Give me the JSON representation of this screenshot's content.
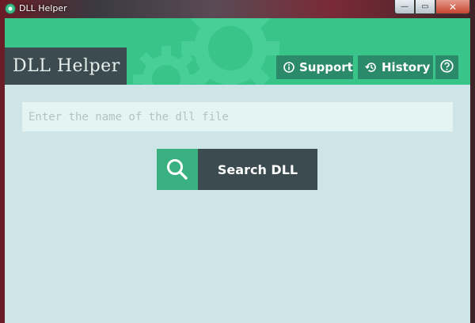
{
  "window": {
    "title": "DLL Helper",
    "close_glyph": "✕",
    "minimize_glyph": "—",
    "maximize_glyph": "▭"
  },
  "header": {
    "app_title": "DLL Helper",
    "support_label": "Support",
    "history_label": "History",
    "help_icon": "question-circle-icon"
  },
  "search": {
    "placeholder": "Enter the name of the dll file",
    "value": "",
    "button_label": "Search DLL",
    "icon": "search-icon"
  },
  "colors": {
    "header_green": "#39c48a",
    "dark_slate": "#3b4b4f",
    "button_green": "#2a8a6a",
    "background": "#cde5e6"
  }
}
